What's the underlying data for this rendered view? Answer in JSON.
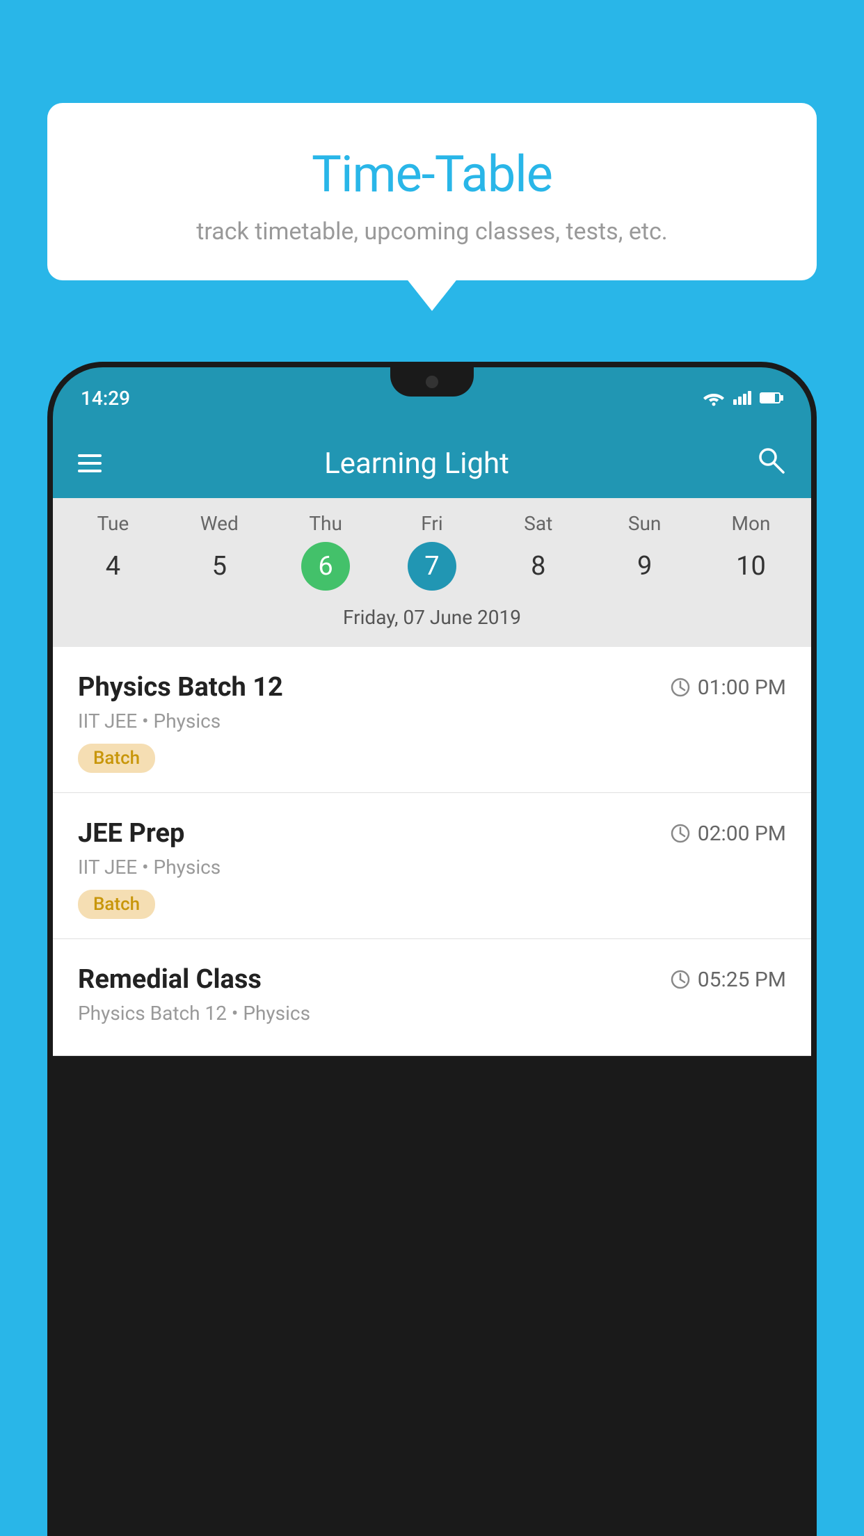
{
  "background_color": "#29b6e8",
  "tooltip": {
    "title": "Time-Table",
    "subtitle": "track timetable, upcoming classes, tests, etc."
  },
  "phone": {
    "status_bar": {
      "time": "14:29"
    },
    "app_header": {
      "title": "Learning Light"
    },
    "calendar": {
      "days": [
        {
          "label": "Tue",
          "number": "4",
          "state": "normal"
        },
        {
          "label": "Wed",
          "number": "5",
          "state": "normal"
        },
        {
          "label": "Thu",
          "number": "6",
          "state": "today"
        },
        {
          "label": "Fri",
          "number": "7",
          "state": "selected"
        },
        {
          "label": "Sat",
          "number": "8",
          "state": "normal"
        },
        {
          "label": "Sun",
          "number": "9",
          "state": "normal"
        },
        {
          "label": "Mon",
          "number": "10",
          "state": "normal"
        }
      ],
      "selected_date_label": "Friday, 07 June 2019"
    },
    "schedule": [
      {
        "title": "Physics Batch 12",
        "time": "01:00 PM",
        "sub": "IIT JEE • Physics",
        "tag": "Batch"
      },
      {
        "title": "JEE Prep",
        "time": "02:00 PM",
        "sub": "IIT JEE • Physics",
        "tag": "Batch"
      },
      {
        "title": "Remedial Class",
        "time": "05:25 PM",
        "sub": "Physics Batch 12 • Physics",
        "tag": null
      }
    ]
  }
}
